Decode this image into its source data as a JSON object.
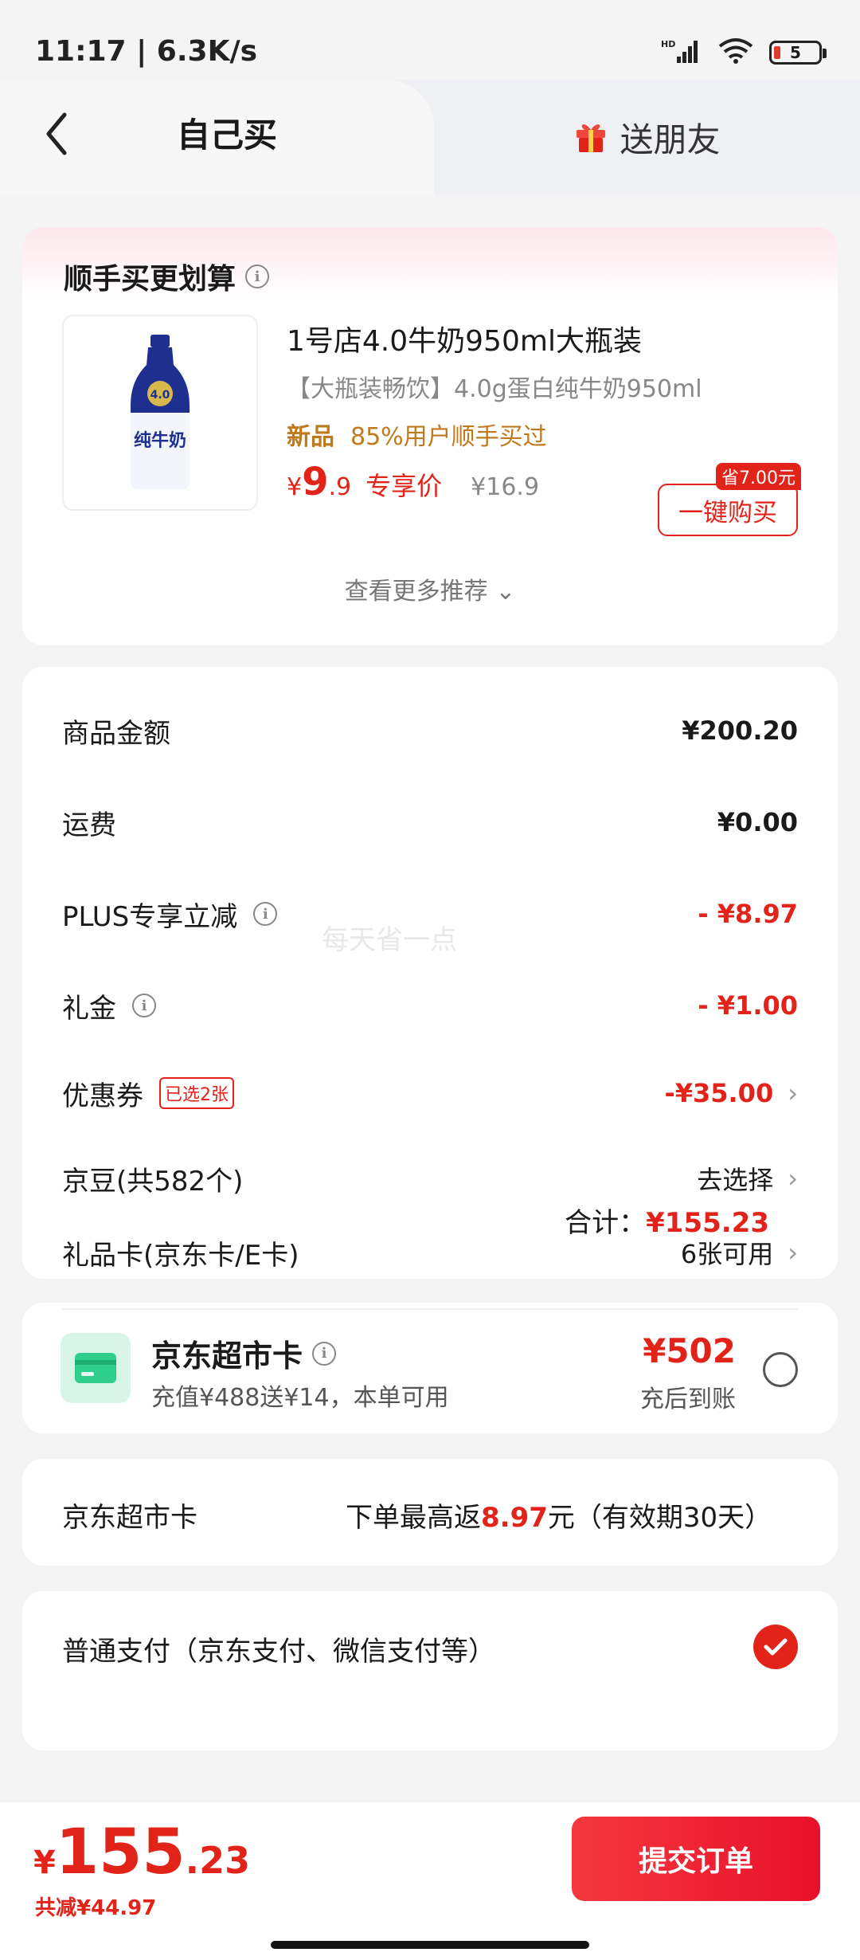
{
  "status_bar": {
    "time": "11:17 | 6.3K/s",
    "network": "HD",
    "battery": "5"
  },
  "tabs": {
    "self_label": "自己买",
    "gift_label": "送朋友"
  },
  "recommend": {
    "title": "顺手买更划算",
    "product": {
      "name": "1号店4.0牛奶950ml大瓶装",
      "subtitle": "【大瓶装畅饮】4.0g蛋白纯牛奶950ml",
      "tag_new": "新品",
      "tag_text": "85%用户顺手买过",
      "price_symbol": "¥",
      "price_int": "9",
      "price_dec": ".9",
      "price_tag": "专享价",
      "original_price": "¥16.9",
      "bottle_label_top": "4.0",
      "bottle_label": "纯牛奶",
      "buy_button": "一键购买",
      "save_badge": "省7.00元"
    },
    "more_link": "查看更多推荐"
  },
  "amounts": {
    "rows": [
      {
        "label": "商品金额",
        "value": "¥200.20"
      },
      {
        "label": "运费",
        "value": "¥0.00"
      },
      {
        "label": "PLUS专享立减",
        "value": "- ¥8.97"
      },
      {
        "label": "礼金",
        "value": "- ¥1.00"
      },
      {
        "label": "优惠券",
        "badge": "已选2张",
        "value": "-¥35.00"
      },
      {
        "label": "京豆(共582个)",
        "value": "去选择"
      },
      {
        "label": "礼品卡(京东卡/E卡)",
        "value": "6张可用"
      }
    ],
    "total_label": "合计：",
    "total_value": "¥155.23",
    "watermark": "每天省一点"
  },
  "supermarket_card": {
    "title": "京东超市卡",
    "subtitle": "充值¥488送¥14，本单可用",
    "amount": "¥502",
    "note": "充后到账"
  },
  "return_card": {
    "label": "京东超市卡",
    "text_before": "下单最高返",
    "amount": "8.97",
    "text_after": "元（有效期30天）"
  },
  "payment": {
    "label": "普通支付（京东支付、微信支付等）"
  },
  "bottom_bar": {
    "price_symbol": "¥",
    "price_int": "155",
    "price_dec": ".23",
    "saved": "共减¥44.97",
    "submit": "提交订单"
  },
  "colors": {
    "accent": "#e2231a",
    "tag": "#c07a1e",
    "card_green": "#2fcf8b"
  }
}
